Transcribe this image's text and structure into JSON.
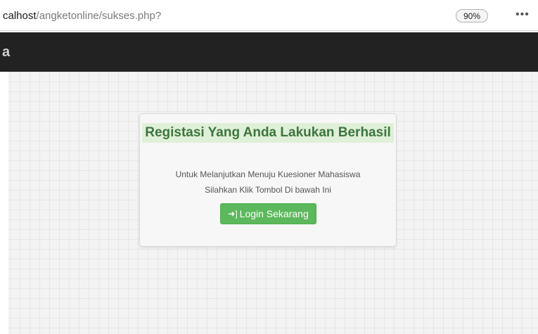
{
  "browser": {
    "url_host": "calhost",
    "url_path": "/angketonline/sukses.php?",
    "zoom": "90%",
    "more_icon": "more-icon"
  },
  "navbar": {
    "brand_fragment": "a"
  },
  "card": {
    "title": "Registasi Yang Anda Lakukan Berhasil",
    "line1": "Untuk Melanjutkan Menuju Kuesioner Mahasiswa",
    "line2": "Silahkan Klik Tombol Di bawah Ini",
    "button_label": "Login Sekarang",
    "button_icon": "sign-in-icon"
  },
  "colors": {
    "navbar": "#222222",
    "title_bg": "#dff0d8",
    "title_text": "#3c763d",
    "button": "#5cb85c"
  }
}
